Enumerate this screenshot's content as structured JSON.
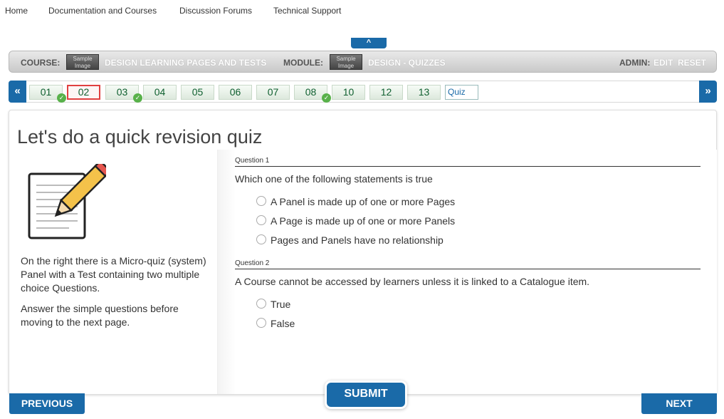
{
  "topnav": {
    "home": "Home",
    "docs": "Documentation and Courses",
    "forums": "Discussion Forums",
    "support": "Technical Support"
  },
  "collapse": "^",
  "coursebar": {
    "course_label": "COURSE:",
    "course_thumb": "Sample Image",
    "course_name": "DESIGN LEARNING PAGES AND TESTS",
    "module_label": "MODULE:",
    "module_thumb": "Sample Image",
    "module_name": "DESIGN - QUIZZES",
    "admin_label": "ADMIN:",
    "edit": "EDIT",
    "reset": "RESET"
  },
  "pagenav": {
    "prev_arrow": "«",
    "next_arrow": "»",
    "pages": [
      {
        "label": "01",
        "done": true
      },
      {
        "label": "02",
        "active": true
      },
      {
        "label": "03",
        "done": true
      },
      {
        "label": "04"
      },
      {
        "label": "05"
      },
      {
        "label": "06"
      },
      {
        "label": "07"
      },
      {
        "label": "08",
        "done": true
      },
      {
        "label": "10"
      },
      {
        "label": "12"
      },
      {
        "label": "13"
      }
    ],
    "quiz": "Quiz"
  },
  "content": {
    "title": "Let's do a quick revision quiz",
    "intro_1": "On the right there is a Micro-quiz (system) Panel with a Test containing two multiple choice Questions.",
    "intro_2": "Answer the simple questions before moving to the next page."
  },
  "quiz": {
    "q1_head": "Question 1",
    "q1_text": "Which one of the following statements is true",
    "q1_options": [
      "A Panel is made up of one or more Pages",
      "A Page is made up of one or more Panels",
      "Pages and Panels have no relationship"
    ],
    "q2_head": "Question 2",
    "q2_text": "A Course cannot be accessed by learners unless it is linked to a Catalogue item.",
    "q2_options": [
      "True",
      "False"
    ]
  },
  "buttons": {
    "previous": "PREVIOUS",
    "submit": "SUBMIT",
    "next": "NEXT"
  },
  "colors": {
    "accent": "#1a6aa8",
    "active_border": "#e04040",
    "check": "#58b14a"
  }
}
